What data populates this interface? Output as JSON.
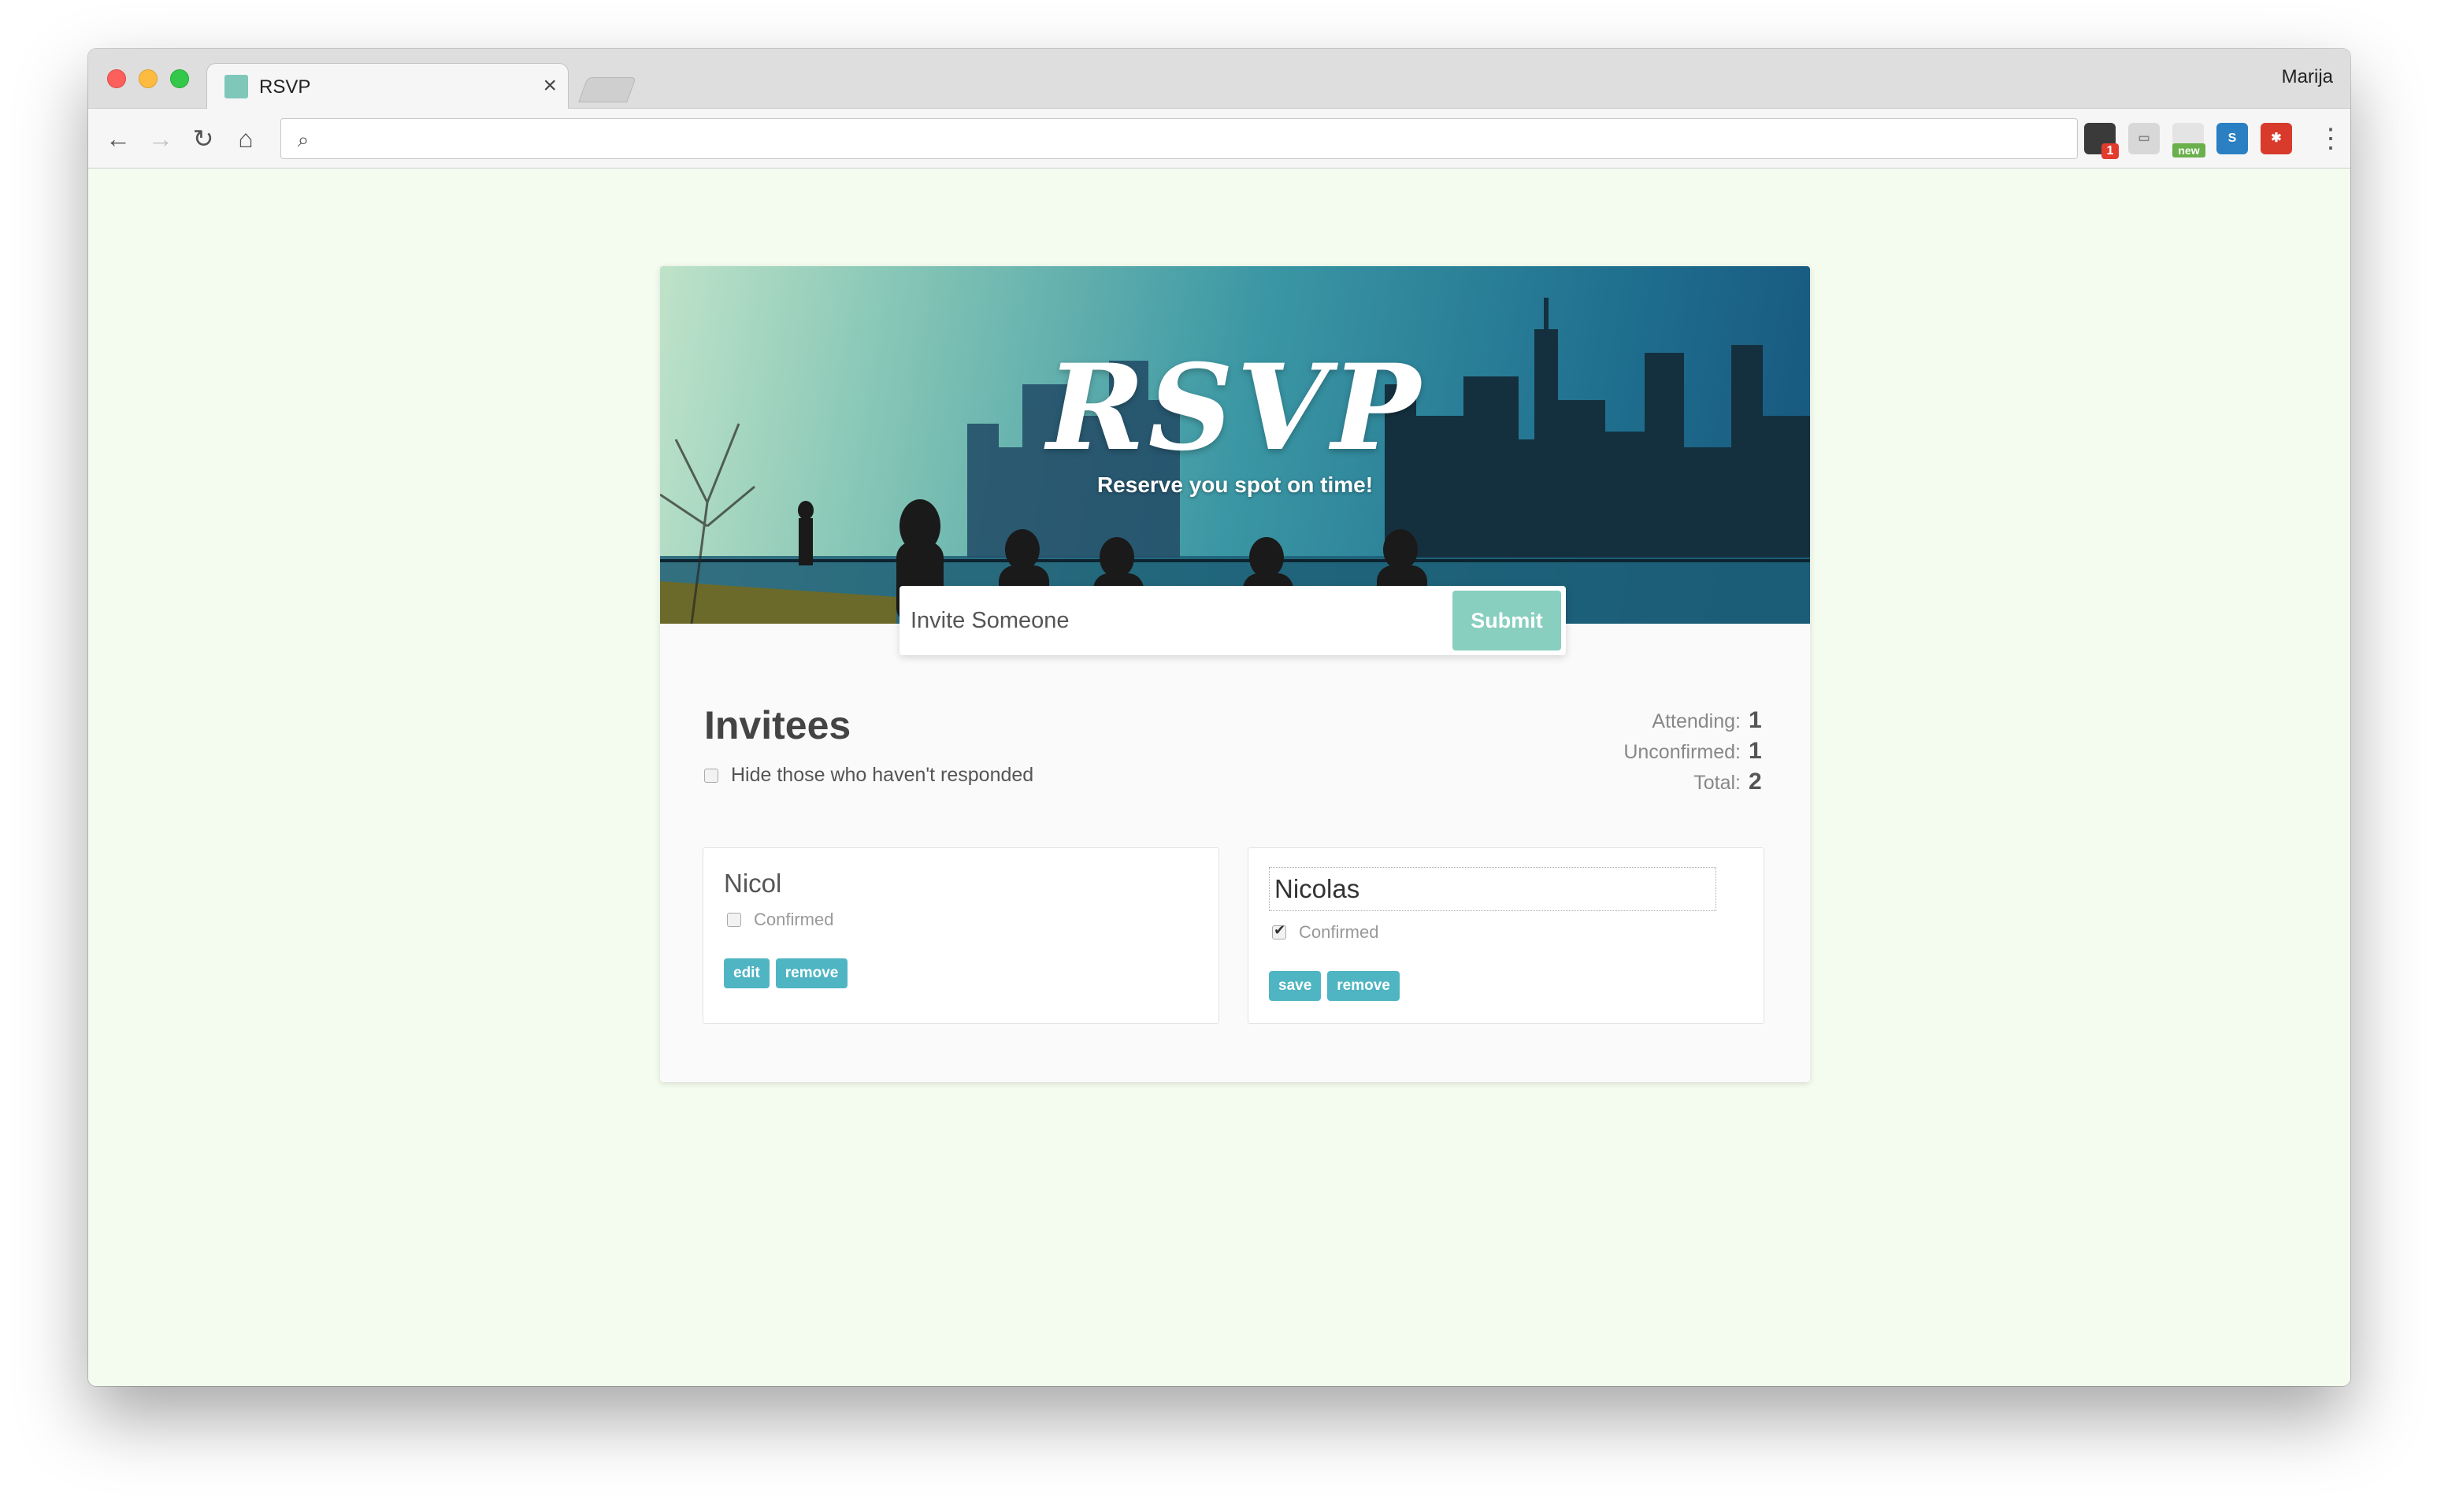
{
  "browser": {
    "tab_title": "RSVP",
    "tab_close": "×",
    "profile_name": "Marija",
    "url": "",
    "extensions": [
      {
        "name": "extension-badge",
        "badge": "1"
      },
      {
        "name": "extension-cast"
      },
      {
        "name": "extension-new",
        "badge": "new"
      },
      {
        "name": "extension-s",
        "label": "S"
      },
      {
        "name": "extension-bug"
      }
    ]
  },
  "hero": {
    "title": "RSVP",
    "subtitle": "Reserve you spot on time!"
  },
  "invite": {
    "placeholder": "Invite Someone",
    "submit_label": "Submit"
  },
  "invitees": {
    "title": "Invitees",
    "hide_label": "Hide those who haven't responded",
    "hide_checked": false
  },
  "counter": {
    "attending_label": "Attending:",
    "attending_value": "1",
    "unconfirmed_label": "Unconfirmed:",
    "unconfirmed_value": "1",
    "total_label": "Total:",
    "total_value": "2"
  },
  "guests": [
    {
      "name": "Nicol",
      "confirmed_label": "Confirmed",
      "confirmed": false,
      "editing": false,
      "edit_label": "edit",
      "remove_label": "remove"
    },
    {
      "name": "Nicolas",
      "confirmed_label": "Confirmed",
      "confirmed": true,
      "editing": true,
      "save_label": "save",
      "remove_label": "remove"
    }
  ],
  "colors": {
    "page_bg": "#f4fbef",
    "accent": "#88cfbf",
    "button": "#4fb5c3"
  }
}
